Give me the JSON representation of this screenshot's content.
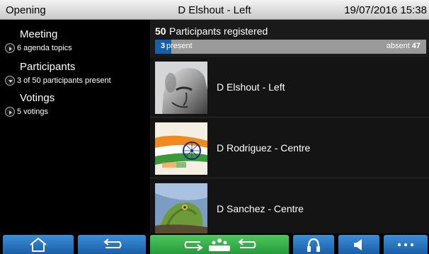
{
  "header": {
    "left_title": "Opening",
    "center_title": "D Elshout - Left",
    "datetime": "19/07/2016 15:38"
  },
  "sidebar": {
    "items": [
      {
        "title": "Meeting",
        "subtitle": "6 agenda topics",
        "expanded": false
      },
      {
        "title": "Participants",
        "subtitle": "3 of 50 participants present",
        "expanded": true
      },
      {
        "title": "Votings",
        "subtitle": "5 votings",
        "expanded": false
      }
    ]
  },
  "registration": {
    "count": "50",
    "label": "Participants registered",
    "present_count": "3",
    "present_label": "present",
    "absent_label": "absent",
    "absent_count": "47",
    "present_fraction": 0.06
  },
  "participants": [
    {
      "name": "D Elshout - Left",
      "photo": "stone-face-sculpture"
    },
    {
      "name": "D Rodriguez - Centre",
      "photo": "india-flag-republic-day"
    },
    {
      "name": "D Sanchez - Centre",
      "photo": "chameleon-lizard"
    }
  ],
  "toolbar": {
    "buttons": [
      {
        "icon": "home-icon",
        "color": "#2f7fcf"
      },
      {
        "icon": "back-arrow-icon",
        "color": "#2f7fcf"
      },
      {
        "icon": "microphone-queue-icon",
        "color": "#3cb44f"
      },
      {
        "icon": "headphones-icon",
        "color": "#2f7fcf"
      },
      {
        "icon": "speaker-icon",
        "color": "#2f7fcf"
      },
      {
        "icon": "more-dots-icon",
        "color": "#2f7fcf"
      }
    ]
  },
  "colors": {
    "accent": "#1560a8",
    "title_bar": "#e0e0e0"
  }
}
